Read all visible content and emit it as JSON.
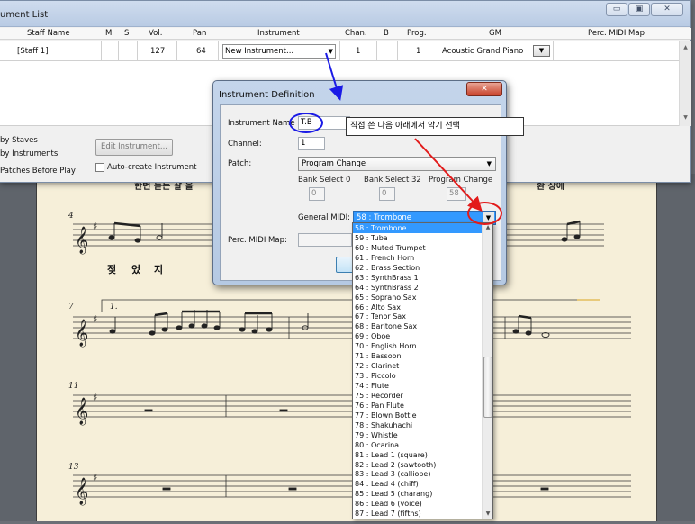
{
  "window": {
    "title": "ument List",
    "buttons": {
      "minimize": "▭",
      "maximize": "▣",
      "close": "✕"
    }
  },
  "grid": {
    "headers": [
      "Staff Name",
      "M",
      "S",
      "Vol.",
      "Pan",
      "Instrument",
      "Chan.",
      "B",
      "Prog.",
      "GM",
      "Perc. MIDI Map"
    ],
    "row": {
      "staff_name": "[Staff 1]",
      "vol": "127",
      "pan": "64",
      "instrument": "New Instrument...",
      "chan": "1",
      "prog": "1",
      "gm": "Acoustic Grand Piano"
    }
  },
  "bottom": {
    "by_staves": "by Staves",
    "by_instruments": "by Instruments",
    "patches_before_play": "Patches Before Play",
    "edit_instrument": "Edit Instrument...",
    "auto_create": "Auto-create Instrument"
  },
  "dialog": {
    "title": "Instrument Definition",
    "close": "✕",
    "instrument_name_label": "Instrument Name",
    "instrument_name_value": "T.B",
    "channel_label": "Channel:",
    "channel_value": "1",
    "patch_label": "Patch:",
    "patch_value": "Program Change",
    "bank0_label": "Bank Select 0",
    "bank0_value": "0",
    "bank32_label": "Bank Select 32",
    "bank32_value": "0",
    "program_change_label": "Program Change",
    "program_change_value": "58",
    "general_midi_label": "General MIDI:",
    "general_midi_value": "58 : Trombone",
    "perc_midi_label": "Perc. MIDI Map:"
  },
  "dropdown": {
    "selected_index": 0,
    "items": [
      "58 : Trombone",
      "59 : Tuba",
      "60 : Muted Trumpet",
      "61 : French Horn",
      "62 : Brass Section",
      "63 : SynthBrass 1",
      "64 : SynthBrass 2",
      "65 : Soprano Sax",
      "66 : Alto Sax",
      "67 : Tenor Sax",
      "68 : Baritone Sax",
      "69 : Oboe",
      "70 : English Horn",
      "71 : Bassoon",
      "72 : Clarinet",
      "73 : Piccolo",
      "74 : Flute",
      "75 : Recorder",
      "76 : Pan Flute",
      "77 : Blown Bottle",
      "78 : Shakuhachi",
      "79 : Whistle",
      "80 : Ocarina",
      "81 : Lead 1 (square)",
      "82 : Lead 2 (sawtooth)",
      "83 : Lead 3 (calliope)",
      "84 : Lead 4 (chiff)",
      "85 : Lead 5 (charang)",
      "86 : Lead 6 (voice)",
      "87 : Lead 7 (fifths)"
    ]
  },
  "annotation": {
    "callout_text": "직접 쓴 다음 아래에서 악기 선택",
    "colors": {
      "blue": "#1a1ae6",
      "red": "#e21b1b"
    }
  },
  "score": {
    "lyric_top_1": "한번 듣는 잘 올",
    "lyric_top_2": "환 상에",
    "measure_numbers": [
      "4",
      "7",
      "11",
      "13"
    ],
    "lyrics_m4": [
      "젖",
      "었",
      "지"
    ],
    "ending_label": "1."
  }
}
